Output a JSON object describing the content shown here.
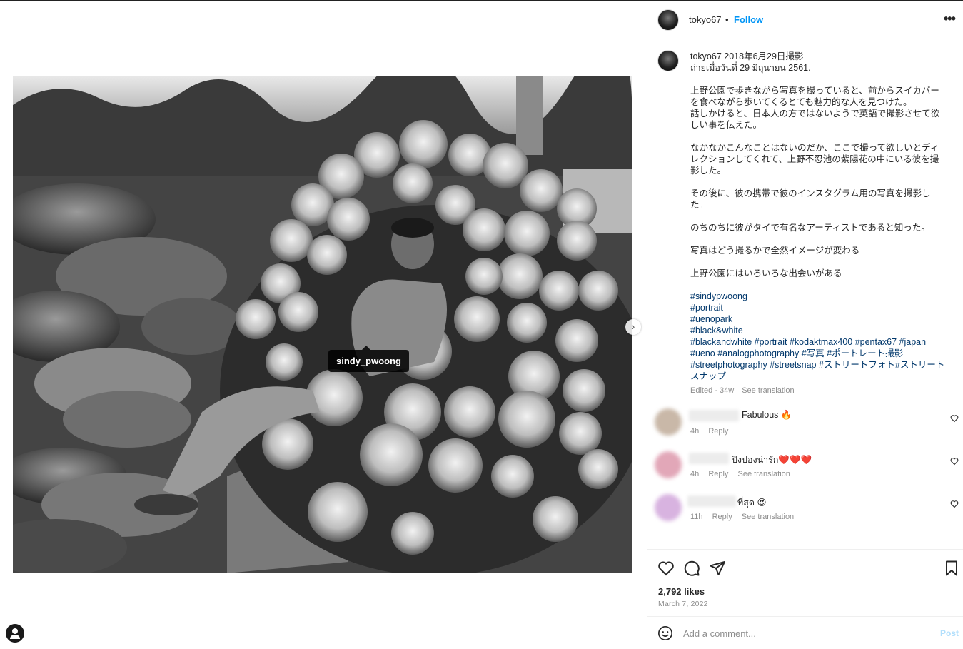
{
  "post": {
    "username": "tokyo67",
    "separator": "•",
    "follow_label": "Follow",
    "more_icon": "more-horizontal-icon",
    "photo_tag": "sindy_pwoong"
  },
  "caption": {
    "username": "tokyo67",
    "lines": [
      "2018年6月29日撮影",
      "ถ่ายเมื่อวันที่ 29 มิถุนายน 2561.",
      "",
      "上野公園で歩きながら写真を撮っていると、前からスイカバーを食べながら歩いてくるとても魅力的な人を見つけた。",
      "話しかけると、日本人の方ではないようで英語で撮影させて欲しい事を伝えた。",
      "",
      "なかなかこんなことはないのだか、ここで撮って欲しいとディレクションしてくれて、上野不忍池の紫陽花の中にいる彼を撮影した。",
      "",
      "その後に、彼の携帯で彼のインスタグラム用の写真を撮影した。",
      "",
      "のちのちに彼がタイで有名なアーティストであると知った。",
      "",
      "写真はどう撮るかで全然イメージが変わる",
      "",
      "上野公園にはいろいろな出会いがある"
    ],
    "hashtags": "#sindypwoong\n#portrait\n#uenopark\n#black&white\n#blackandwhite #portrait #kodaktmax400 #pentax67 #japan #ueno #analogphotography #写真 #ポートレート撮影 #streetphotography #streetsnap #ストリートフォト#ストリートスナップ",
    "edited": "Edited · 34w",
    "see_translation": "See translation"
  },
  "comments": [
    {
      "text": "Fabulous 🔥",
      "time": "4h",
      "reply": "Reply",
      "see_translation": "",
      "avatar_color": "#c9b8a8"
    },
    {
      "text": "ปิงปองน่ารัก❤️❤️❤️",
      "time": "4h",
      "reply": "Reply",
      "see_translation": "See translation",
      "avatar_color": "#e2a7b8"
    },
    {
      "text": "ที่สุด 😍",
      "time": "11h",
      "reply": "Reply",
      "see_translation": "See translation",
      "avatar_color": "#d8b3e0"
    }
  ],
  "actions": {
    "like_icon": "heart-icon",
    "comment_icon": "comment-bubble-icon",
    "share_icon": "share-paper-plane-icon",
    "save_icon": "bookmark-icon",
    "likes": "2,792 likes",
    "date": "March 7, 2022"
  },
  "add_comment": {
    "emoji_icon": "emoji-smile-icon",
    "placeholder": "Add a comment...",
    "post_label": "Post"
  },
  "colors": {
    "link": "#0095f6",
    "hashtag": "#00376b",
    "muted": "#8e8e8e",
    "post_disabled": "#b2dffc"
  }
}
